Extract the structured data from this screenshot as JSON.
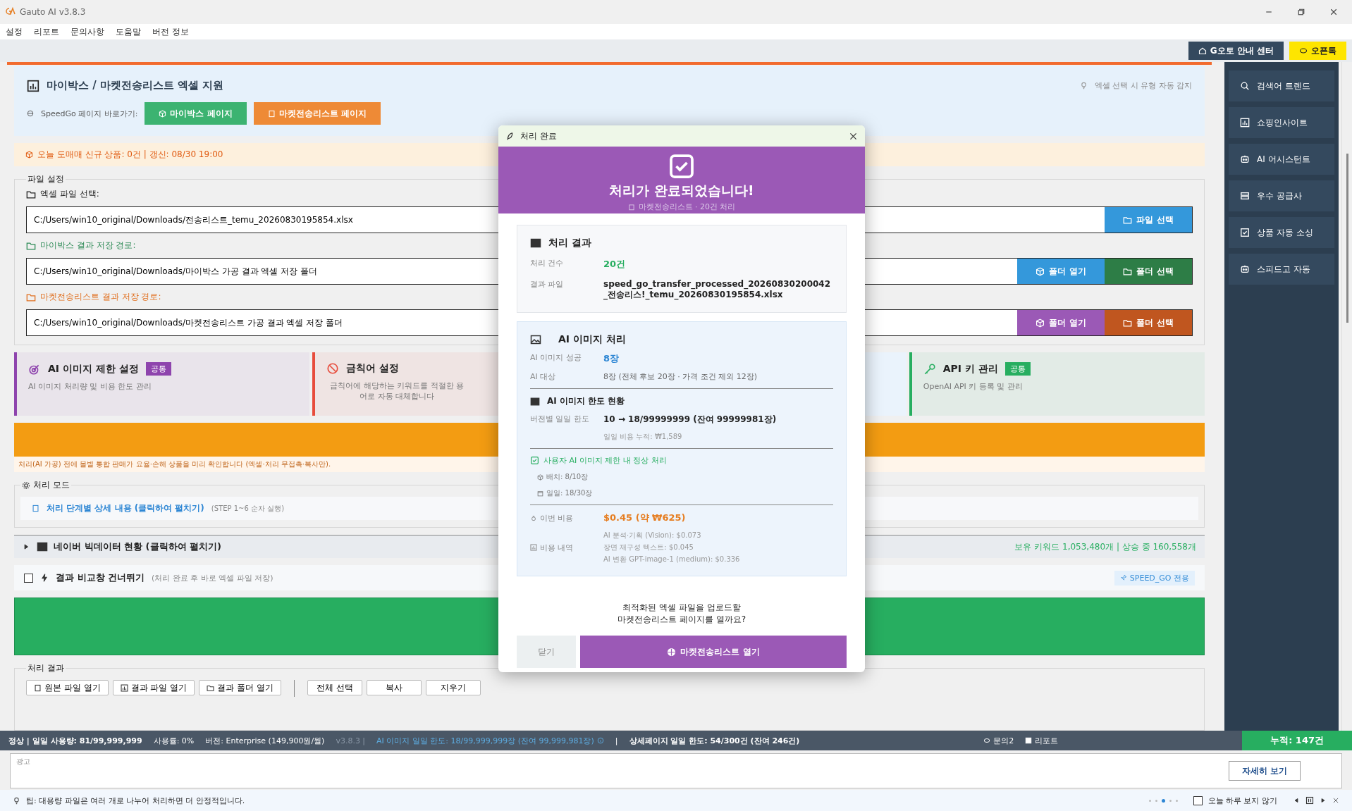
{
  "window": {
    "title": "Gauto AI v3.8.3"
  },
  "menu": [
    "설정",
    "리포트",
    "문의사항",
    "도움말",
    "버전 정보"
  ],
  "toolbar_buttons": [
    {
      "label": "G오토 안내 센터",
      "kind": "guide"
    },
    {
      "label": "오픈톡",
      "kind": "talk"
    }
  ],
  "header": {
    "title": "마이박스 / 마켓전송리스트 엑셀 지원",
    "hint": "엑셀 선택 시 유형 자동 감지",
    "shortcut_label": "SpeedGo 페이지 바로가기:",
    "shortcut_buttons": [
      {
        "label": "마이박스 페이지",
        "color": "#3cb371"
      },
      {
        "label": "마켓전송리스트 페이지",
        "color": "#ee8a36"
      }
    ]
  },
  "notice": "오늘 도매매 신규 상품: 0건 | 갱신: 08/30 19:00",
  "file_settings": {
    "title": "파일 설정",
    "rows": [
      {
        "label": "엑셀 파일 선택:",
        "color": "#222222",
        "value": "C:/Users/win10_original/Downloads/전송리스트_temu_20260830195854.xlsx",
        "buttons": [
          {
            "label": "파일 선택",
            "color": "#3498db"
          }
        ]
      },
      {
        "label": "마이박스 결과 저장 경로:",
        "color": "#2e8b57",
        "value": "C:/Users/win10_original/Downloads/마이박스 가공 결과 엑셀 저장 폴더",
        "buttons": [
          {
            "label": "폴더 열기",
            "color": "#3498db"
          },
          {
            "label": "폴더 선택",
            "color": "#2d7d46"
          }
        ]
      },
      {
        "label": "마켓전송리스트 결과 저장 경로:",
        "color": "#e07020",
        "value": "C:/Users/win10_original/Downloads/마켓전송리스트 가공 결과 엑셀 저장 폴더",
        "buttons": [
          {
            "label": "폴더 열기",
            "color": "#9b59b6"
          },
          {
            "label": "폴더 선택",
            "color": "#c0561f"
          }
        ]
      }
    ]
  },
  "cards": [
    {
      "title": "AI 이미지 제한 설정",
      "badge": "공통",
      "desc": "AI 이미지 처리량 및 비용 한도 관리",
      "color": "#8e44ad"
    },
    {
      "title": "금칙어 설정",
      "desc": "금칙어에 해당하는 키워드를 적절한 용어로 자동 대체합니다",
      "color": "#e74c3c"
    },
    {
      "title": "API 키 관리",
      "badge": "공통",
      "desc": "OpenAI API 키 등록 및 관리",
      "color": "#27ae60"
    }
  ],
  "banner_note": "처리(AI 가공) 전에 몰별 통합 판매가 요율·손해 상품을 미리 확인합니다 (엑셀·처리 무접촉·복사만).",
  "processing_mode": {
    "title": "처리 모드",
    "link": "처리 단계별 상세 내용 (클릭하여 펼치기)",
    "note": "(STEP 1~6 순차 실행)"
  },
  "naver": {
    "title": "네이버 빅데이터 현황 (클릭하여 펼치기)",
    "expanded": false,
    "stats": "보유 키워드 1,053,480개 | 상승 중 160,558개"
  },
  "skip_compare": {
    "label": "결과 비교창 건너뛰기",
    "checked": false,
    "note": "(처리 완료 후 바로 엑셀 파일 저장)",
    "badge": "SPEED_GO 전용"
  },
  "results": {
    "title": "처리 결과",
    "file_buttons": [
      "원본 파일 열기",
      "결과 파일 열기",
      "결과 폴더 열기"
    ],
    "edit_buttons": [
      "전체 선택",
      "복사",
      "지우기"
    ]
  },
  "sidebar": [
    "검색어 트렌드",
    "쇼핑인사이트",
    "AI 어시스턴트",
    "우수 공급사",
    "상품 자동 소싱",
    "스피드고 자동"
  ],
  "status_bar": {
    "usage": "정상 | 일일 사용량: 81/99,999,999",
    "rate": "사용률: 0%",
    "version": "버전: Enterprise (149,900원/월)",
    "build": "v3.8.3 |",
    "ai_limit": "AI 이미지 일일 한도: 18/99,999,999장 (잔여 99,999,981장)",
    "separator": "|",
    "detail_limit": "상세페이지 일일 한도: 54/300건 (잔여 246건)",
    "inquiry": "문의2",
    "report": "리포트",
    "total": "누적: 147건"
  },
  "ad": {
    "label": "광고",
    "button": "자세히 보기"
  },
  "tip": {
    "text": "팁: 대용량 파일은 여러 개로 나누어 처리하면 더 안정적입니다.",
    "dots": [
      {
        "selected": false
      },
      {
        "selected": false
      },
      {
        "selected": true
      },
      {
        "selected": false
      },
      {
        "selected": false
      }
    ],
    "hide_today": {
      "label": "오늘 하루 보지 않기",
      "checked": false
    }
  },
  "dialog": {
    "title": "처리 완료",
    "headline": "처리가 완료되었습니다!",
    "subtitle": "마켓전송리스트 · 20건 처리",
    "result": {
      "title": "처리 결과",
      "rows": [
        {
          "label": "처리 건수",
          "value": "20건"
        },
        {
          "label": "결과 파일",
          "value": "speed_go_transfer_processed_20260830200042_전송리스!_temu_20260830195854.xlsx"
        }
      ]
    },
    "ai": {
      "title": "AI 이미지 처리",
      "success_label": "AI 이미지 성공",
      "success_value": "8장",
      "target_label": "AI 대상",
      "target_value": "8장  (전체 후보 20장 · 가격 조건 제외 12장)",
      "limit_title": "AI 이미지 한도 현황",
      "limit_label": "버전별 일일 한도",
      "limit_value": "10 → 18/99999999 (잔여 99999981장)",
      "cost_accum": "일일 비용 누적: ₩1,589",
      "ok_text": "사용자 AI 이미지 제한 내 정상 처리",
      "batch": "배치: 8/10장",
      "daily": "일일: 18/30장",
      "cost_label": "이번 비용",
      "cost_value": "$0.45 (약 ₩625)",
      "breakdown_label": "비용 내역",
      "breakdown": [
        "AI 분석·기획 (Vision): $0.073",
        "장면 재구성 텍스트: $0.045",
        "AI 변환 GPT-image-1 (medium): $0.336"
      ]
    },
    "question": [
      "최적화된 엑셀 파일을 업로드할",
      "마켓전송리스트 페이지를 열까요?"
    ],
    "buttons": [
      {
        "label": "닫기",
        "kind": "secondary"
      },
      {
        "label": "마켓전송리스트 열기",
        "kind": "primary"
      }
    ]
  }
}
